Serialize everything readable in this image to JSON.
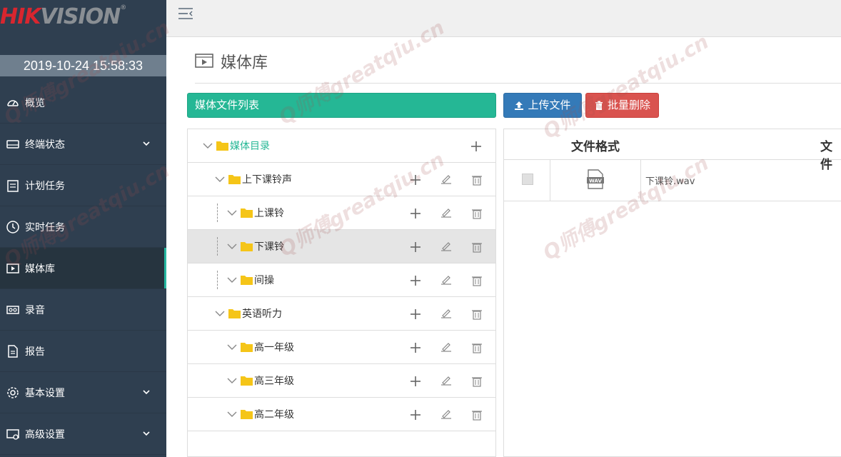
{
  "logo": {
    "part1": "HIK",
    "part2": "VISION",
    "reg": "®"
  },
  "datetime": "2019-10-24 15:58:33",
  "sidebar": {
    "items": [
      {
        "label": "概览",
        "icon": "dashboard-icon",
        "expandable": false
      },
      {
        "label": "终端状态",
        "icon": "terminal-icon",
        "expandable": true
      },
      {
        "label": "计划任务",
        "icon": "schedule-icon",
        "expandable": false
      },
      {
        "label": "实时任务",
        "icon": "clock-icon",
        "expandable": false
      },
      {
        "label": "媒体库",
        "icon": "media-icon",
        "expandable": false,
        "active": true
      },
      {
        "label": "录音",
        "icon": "recording-icon",
        "expandable": false
      },
      {
        "label": "报告",
        "icon": "report-icon",
        "expandable": false
      },
      {
        "label": "基本设置",
        "icon": "gear-icon",
        "expandable": true
      },
      {
        "label": "高级设置",
        "icon": "advanced-settings-icon",
        "expandable": true
      }
    ]
  },
  "page": {
    "title": "媒体库"
  },
  "list_title": "媒体文件列表",
  "buttons": {
    "upload": "上传文件",
    "batch_delete": "批量删除"
  },
  "tree": {
    "root": "媒体目录",
    "nodes": [
      {
        "label": "上下课铃声",
        "level": 1
      },
      {
        "label": "上课铃",
        "level": 2
      },
      {
        "label": "下课铃",
        "level": 2,
        "selected": true
      },
      {
        "label": "间操",
        "level": 2
      },
      {
        "label": "英语听力",
        "level": 1
      },
      {
        "label": "高一年级",
        "level": 2
      },
      {
        "label": "高三年级",
        "level": 2
      },
      {
        "label": "高二年级",
        "level": 2
      }
    ]
  },
  "table": {
    "headers": [
      "文件格式",
      "文件"
    ],
    "rows": [
      {
        "format": "WAV",
        "name": "下课铃.wav"
      }
    ]
  },
  "watermark": "Q师傅greatqiu.cn",
  "colors": {
    "sidebar": "#2f3f50",
    "accent": "#25b795",
    "primary": "#347ab8",
    "danger": "#d9534f"
  }
}
